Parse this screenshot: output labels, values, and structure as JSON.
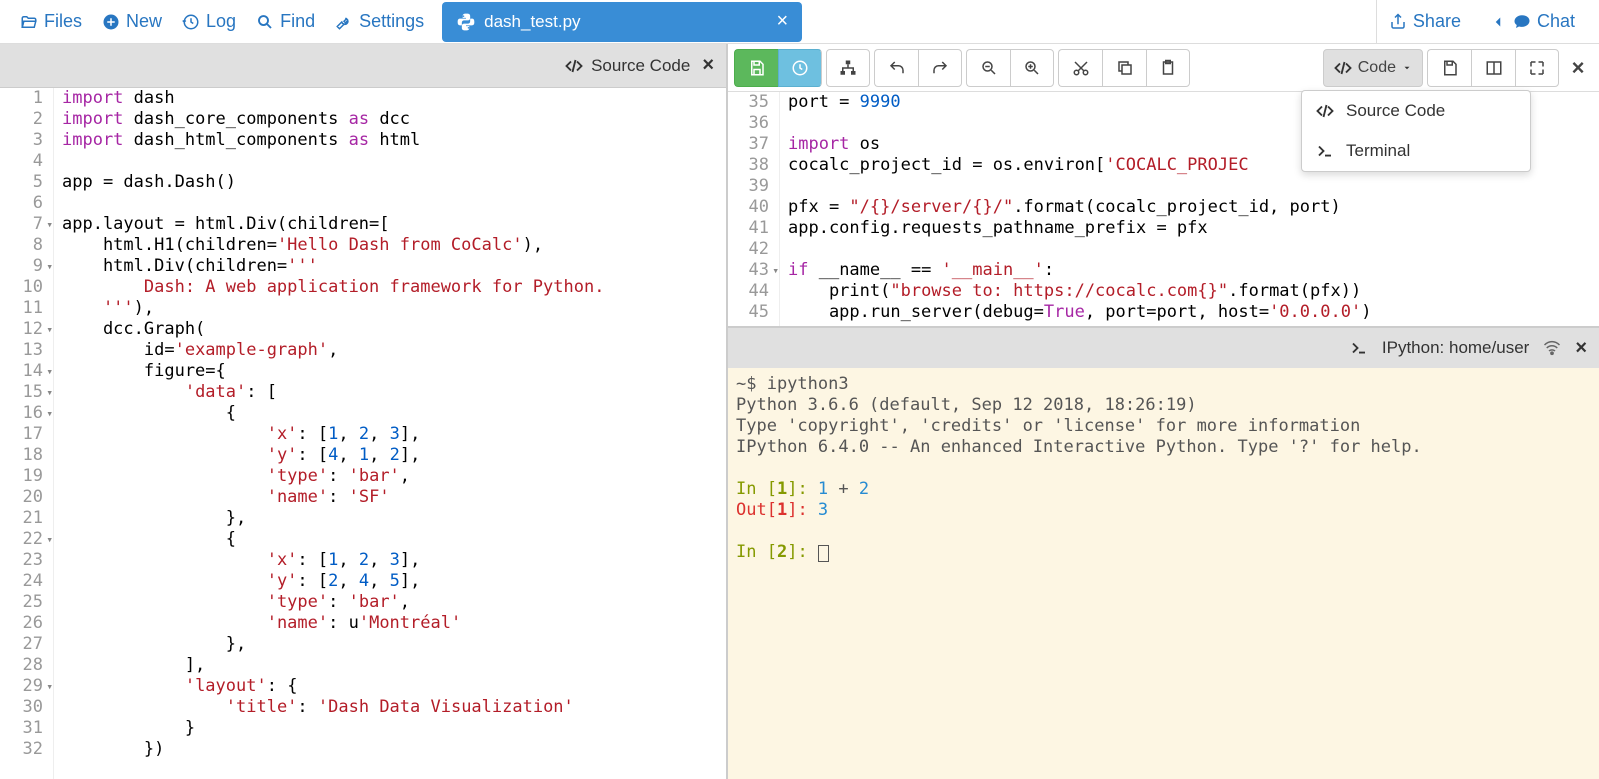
{
  "topmenu": {
    "files": "Files",
    "new": "New",
    "log": "Log",
    "find": "Find",
    "settings": "Settings"
  },
  "filetab": {
    "name": "dash_test.py"
  },
  "topright": {
    "share": "Share",
    "chat": "Chat"
  },
  "leftpane": {
    "header": "Source Code",
    "lines": [
      1,
      2,
      3,
      4,
      5,
      6,
      7,
      8,
      9,
      10,
      11,
      12,
      13,
      14,
      15,
      16,
      17,
      18,
      19,
      20,
      21,
      22,
      23,
      24,
      25,
      26,
      27,
      28,
      29,
      30,
      31,
      32
    ],
    "folds": [
      7,
      9,
      12,
      14,
      15,
      16,
      22,
      29
    ]
  },
  "rightpane": {
    "lines": [
      35,
      36,
      37,
      38,
      39,
      40,
      41,
      42,
      43,
      44,
      45
    ],
    "folds": [
      43
    ],
    "dropdown_label": "Code",
    "dropdown_items": {
      "src": "Source Code",
      "term": "Terminal"
    },
    "code": {
      "l35_a": "port = ",
      "l35_b": "9990",
      "l37_a": "import",
      "l37_b": " os",
      "l38_a": "cocalc_project_id = os.environ[",
      "l38_b": "'COCALC_PROJEC",
      "l40_a": "pfx = ",
      "l40_b": "\"/{}/server/{}/\"",
      "l40_c": ".format(cocalc_project_id, port)",
      "l41": "app.config.requests_pathname_prefix = pfx",
      "l43_a": "if",
      "l43_b": " __name__ == ",
      "l43_c": "'__main__'",
      "l43_d": ":",
      "l44_a": "    print(",
      "l44_b": "\"browse to: https://cocalc.com{}\"",
      "l44_c": ".format(pfx))",
      "l45_a": "    app.run_server(debug=",
      "l45_b": "True",
      "l45_c": ", port=port, host=",
      "l45_d": "'0.0.0.0'",
      "l45_e": ")"
    }
  },
  "terminal": {
    "label": "IPython: home/user",
    "lines": {
      "prompt": "~$ ipython3",
      "ver": "Python 3.6.6 (default, Sep 12 2018, 18:26:19)",
      "info": "Type 'copyright', 'credits' or 'license' for more information",
      "ipy": "IPython 6.4.0 -- An enhanced Interactive Python. Type '?' for help.",
      "in1a": "In [",
      "in1b": "1",
      "in1c": "]: ",
      "in1d": "1",
      "in1e": " + ",
      "in1f": "2",
      "out1a": "Out[",
      "out1b": "1",
      "out1c": "]: ",
      "out1d": "3",
      "in2a": "In [",
      "in2b": "2",
      "in2c": "]: "
    }
  },
  "leftcode": {
    "l1a": "import",
    "l1b": " dash",
    "l2a": "import",
    "l2b": " dash_core_components ",
    "l2c": "as",
    "l2d": " dcc",
    "l3a": "import",
    "l3b": " dash_html_components ",
    "l3c": "as",
    "l3d": " html",
    "l5": "app = dash.Dash()",
    "l7": "app.layout = html.Div(children=[",
    "l8a": "    html.H1(children=",
    "l8b": "'Hello Dash from CoCalc'",
    "l8c": "),",
    "l9a": "    html.Div(children=",
    "l9b": "'''",
    "l10": "        Dash: A web application framework for Python.",
    "l11a": "    '''",
    "l11b": "),",
    "l12": "    dcc.Graph(",
    "l13a": "        id=",
    "l13b": "'example-graph'",
    "l13c": ",",
    "l14": "        figure={",
    "l15a": "            ",
    "l15b": "'data'",
    "l15c": ": [",
    "l16": "                {",
    "l17a": "                    ",
    "l17b": "'x'",
    "l17c": ": [",
    "l17d": "1",
    "l17e": ", ",
    "l17f": "2",
    "l17g": ", ",
    "l17h": "3",
    "l17i": "],",
    "l18a": "                    ",
    "l18b": "'y'",
    "l18c": ": [",
    "l18d": "4",
    "l18e": ", ",
    "l18f": "1",
    "l18g": ", ",
    "l18h": "2",
    "l18i": "],",
    "l19a": "                    ",
    "l19b": "'type'",
    "l19c": ": ",
    "l19d": "'bar'",
    "l19e": ",",
    "l20a": "                    ",
    "l20b": "'name'",
    "l20c": ": ",
    "l20d": "'SF'",
    "l21": "                },",
    "l22": "                {",
    "l23a": "                    ",
    "l23b": "'x'",
    "l23c": ": [",
    "l23d": "1",
    "l23e": ", ",
    "l23f": "2",
    "l23g": ", ",
    "l23h": "3",
    "l23i": "],",
    "l24a": "                    ",
    "l24b": "'y'",
    "l24c": ": [",
    "l24d": "2",
    "l24e": ", ",
    "l24f": "4",
    "l24g": ", ",
    "l24h": "5",
    "l24i": "],",
    "l25a": "                    ",
    "l25b": "'type'",
    "l25c": ": ",
    "l25d": "'bar'",
    "l25e": ",",
    "l26a": "                    ",
    "l26b": "'name'",
    "l26c": ": u",
    "l26d": "'Montréal'",
    "l27": "                },",
    "l28": "            ],",
    "l29a": "            ",
    "l29b": "'layout'",
    "l29c": ": {",
    "l30a": "                ",
    "l30b": "'title'",
    "l30c": ": ",
    "l30d": "'Dash Data Visualization'",
    "l31": "            }",
    "l32": "        })"
  }
}
